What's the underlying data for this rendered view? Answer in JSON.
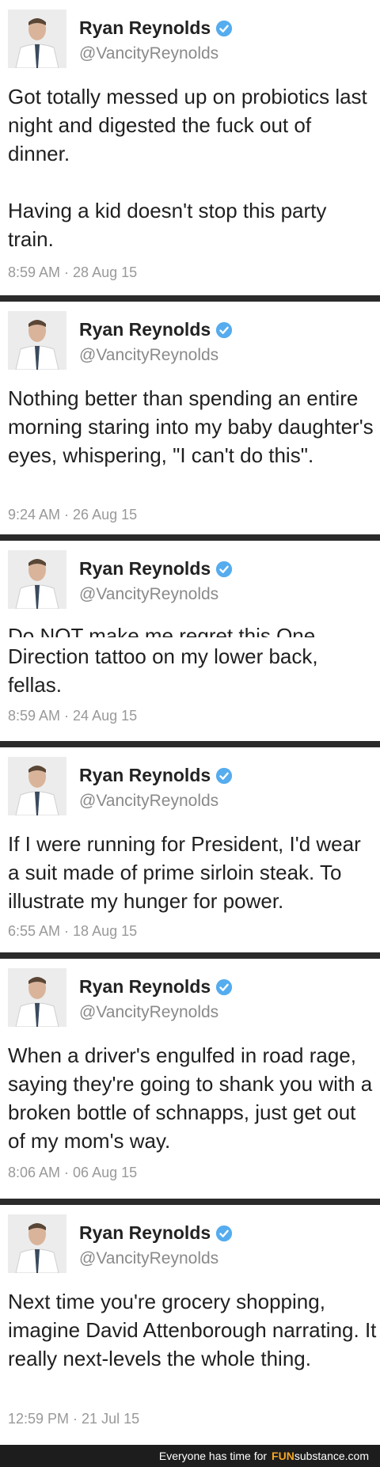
{
  "tweets": [
    {
      "name": "Ryan Reynolds",
      "handle": "@VancityReynolds",
      "paragraphs": [
        "Got totally messed up on probiotics last night and digested the fuck out of dinner.",
        "Having a kid doesn't stop this party train."
      ],
      "timestamp": "8:59 AM · 28 Aug 15"
    },
    {
      "name": "Ryan Reynolds",
      "handle": "@VancityReynolds",
      "paragraphs": [
        "Nothing better than spending an entire morning staring into my baby daughter's eyes, whispering, \"I can't do this\"."
      ],
      "timestamp": "9:24 AM · 26 Aug 15"
    },
    {
      "name": "Ryan Reynolds",
      "handle": "@VancityReynolds",
      "cropped_line": "Do NOT make me regret this One",
      "paragraphs": [
        "Direction tattoo on my lower back, fellas."
      ],
      "timestamp": "8:59 AM · 24 Aug 15"
    },
    {
      "name": "Ryan Reynolds",
      "handle": "@VancityReynolds",
      "paragraphs": [
        "If I were running for President, I'd wear a suit made of prime sirloin steak. To illustrate my hunger for power."
      ],
      "timestamp": "6:55 AM · 18 Aug 15"
    },
    {
      "name": "Ryan Reynolds",
      "handle": "@VancityReynolds",
      "paragraphs": [
        "When a driver's engulfed in road rage, saying they're going to shank you with a broken bottle of schnapps, just get out of my mom's way."
      ],
      "timestamp": "8:06 AM · 06 Aug 15"
    },
    {
      "name": "Ryan Reynolds",
      "handle": "@VancityReynolds",
      "paragraphs": [
        "Next time you're grocery shopping, imagine David Attenborough narrating. It really next-levels the whole thing."
      ],
      "timestamp": "12:59 PM · 21 Jul 15"
    }
  ],
  "footer": {
    "slogan": "Everyone has time for",
    "brand_a": "FUN",
    "brand_b": "substance.com"
  },
  "colors": {
    "verified": "#55acee",
    "divider": "#2b2b2b",
    "meta": "#999999",
    "handle": "#8a8a8a",
    "brand": "#f5a623"
  }
}
